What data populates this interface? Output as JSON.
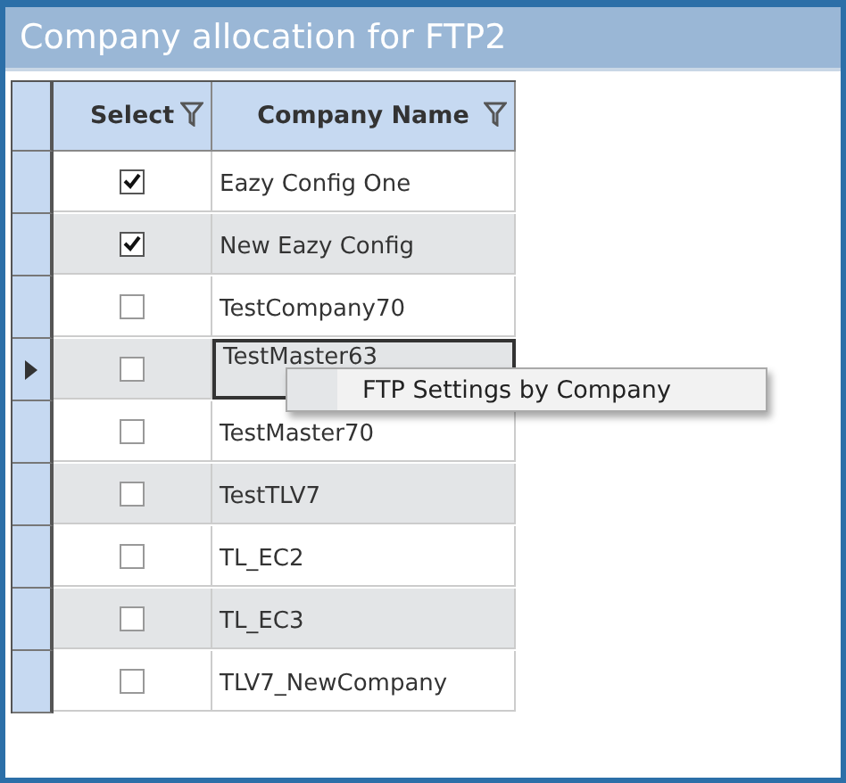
{
  "window": {
    "title": "Company allocation for FTP2"
  },
  "table": {
    "columns": [
      {
        "label": "Select",
        "filter": true
      },
      {
        "label": "Company Name",
        "filter": true
      }
    ],
    "rows": [
      {
        "checked": true,
        "name": "Eazy Config One",
        "selected": false
      },
      {
        "checked": true,
        "name": "New Eazy Config",
        "selected": false
      },
      {
        "checked": false,
        "name": "TestCompany70",
        "selected": false
      },
      {
        "checked": false,
        "name": "TestMaster63",
        "selected": true
      },
      {
        "checked": false,
        "name": "TestMaster70",
        "selected": false
      },
      {
        "checked": false,
        "name": "TestTLV7",
        "selected": false
      },
      {
        "checked": false,
        "name": "TL_EC2",
        "selected": false
      },
      {
        "checked": false,
        "name": "TL_EC3",
        "selected": false
      },
      {
        "checked": false,
        "name": "TLV7_NewCompany",
        "selected": false
      }
    ]
  },
  "context_menu": {
    "items": [
      {
        "label": "FTP Settings by Company"
      }
    ]
  }
}
